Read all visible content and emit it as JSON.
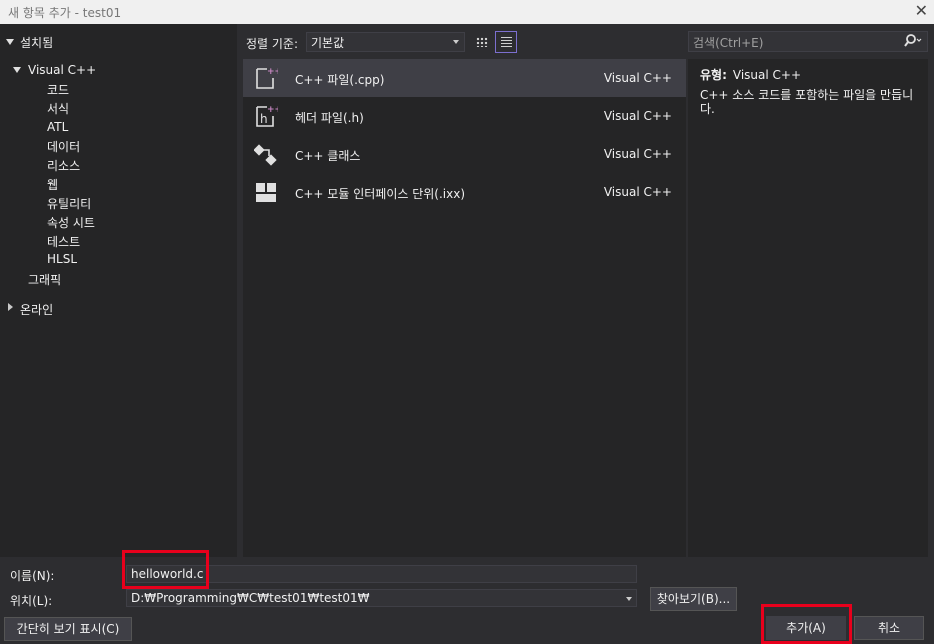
{
  "window": {
    "title": "새 항목 추가 - test01",
    "close_glyph": "✕"
  },
  "left": {
    "header": "설치됨",
    "tree": [
      {
        "label": "Visual C++"
      },
      {
        "label": "코드"
      },
      {
        "label": "서식"
      },
      {
        "label": "ATL"
      },
      {
        "label": "데이터"
      },
      {
        "label": "리소스"
      },
      {
        "label": "웹"
      },
      {
        "label": "유틸리티"
      },
      {
        "label": "속성 시트"
      },
      {
        "label": "테스트"
      },
      {
        "label": "HLSL"
      },
      {
        "label": "그래픽"
      },
      {
        "label": "온라인"
      }
    ]
  },
  "toolbar": {
    "sort_label": "정렬 기준:",
    "sort_value": "기본값"
  },
  "templates": [
    {
      "name": "C++ 파일(.cpp)",
      "lang": "Visual C++",
      "icon": "cpp-file-icon"
    },
    {
      "name": "헤더 파일(.h)",
      "lang": "Visual C++",
      "icon": "header-file-icon"
    },
    {
      "name": "C++ 클래스",
      "lang": "Visual C++",
      "icon": "class-icon"
    },
    {
      "name": "C++ 모듈 인터페이스 단위(.ixx)",
      "lang": "Visual C++",
      "icon": "module-icon"
    }
  ],
  "search": {
    "placeholder": "검색(Ctrl+E)"
  },
  "details": {
    "type_label": "유형:",
    "type_value": "Visual C++",
    "description": "C++ 소스 코드를 포함하는 파일을 만듭니다."
  },
  "form": {
    "name_label": "이름(N):",
    "name_value": "helloworld.c",
    "location_label": "위치(L):",
    "location_value": "D:₩Programming₩C₩test01₩test01₩",
    "browse_label": "찾아보기(B)...",
    "compact_label": "간단히 보기 표시(C)",
    "add_label": "추가(A)",
    "cancel_label": "취소"
  },
  "colors": {
    "accent": "#7c6fcf",
    "highlight": "#e8001c",
    "icon_purple": "#c586c0"
  }
}
